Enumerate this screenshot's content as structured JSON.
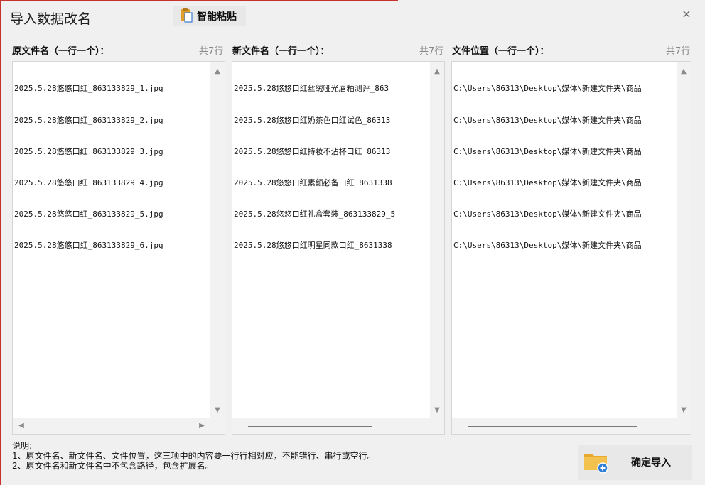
{
  "window": {
    "title": "导入数据改名",
    "close_symbol": "×"
  },
  "toolbar": {
    "paste_label": "智能粘贴",
    "paste_icon": "clipboard-icon"
  },
  "columns": [
    {
      "header": "原文件名（一行一个）：",
      "count": "共7行",
      "lines": [
        "2025.5.28悠悠口红_863133829_1.jpg",
        "2025.5.28悠悠口红_863133829_2.jpg",
        "2025.5.28悠悠口红_863133829_3.jpg",
        "2025.5.28悠悠口红_863133829_4.jpg",
        "2025.5.28悠悠口红_863133829_5.jpg",
        "2025.5.28悠悠口红_863133829_6.jpg"
      ]
    },
    {
      "header": "新文件名（一行一个）：",
      "count": "共7行",
      "lines": [
        "2025.5.28悠悠口红丝绒哑光唇釉测评_863",
        "2025.5.28悠悠口红奶茶色口红试色_86313",
        "2025.5.28悠悠口红持妆不沾杯口红_86313",
        "2025.5.28悠悠口红素颜必备口红_8631338",
        "2025.5.28悠悠口红礼盒套装_863133829_5",
        "2025.5.28悠悠口红明星同款口红_8631338"
      ]
    },
    {
      "header": "文件位置（一行一个）：",
      "count": "共7行",
      "lines": [
        "C:\\Users\\86313\\Desktop\\媒体\\新建文件夹\\商品",
        "C:\\Users\\86313\\Desktop\\媒体\\新建文件夹\\商品",
        "C:\\Users\\86313\\Desktop\\媒体\\新建文件夹\\商品",
        "C:\\Users\\86313\\Desktop\\媒体\\新建文件夹\\商品",
        "C:\\Users\\86313\\Desktop\\媒体\\新建文件夹\\商品",
        "C:\\Users\\86313\\Desktop\\媒体\\新建文件夹\\商品"
      ]
    }
  ],
  "notes": {
    "title": "说明:",
    "line1": "1、原文件名、新文件名、文件位置，这三项中的内容要一行行相对应，不能错行、串行或空行。",
    "line2": "2、原文件名和新文件名中不包含路径，包含扩展名。"
  },
  "confirm": {
    "label": "确定导入",
    "icon": "folder-add-icon"
  },
  "colors": {
    "accent_red": "#c8322d",
    "folder_yellow": "#f2c14e",
    "plus_blue": "#2f80d6"
  }
}
